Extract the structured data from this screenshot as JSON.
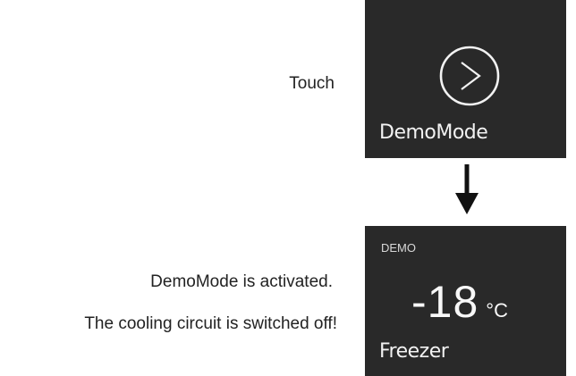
{
  "steps": {
    "touch": "Touch",
    "activated": "DemoMode is activated.",
    "warning": "The cooling circuit is switched off!"
  },
  "screen_top": {
    "label": "DemoMode",
    "button_icon": "chevron-right-circle-icon"
  },
  "screen_bottom": {
    "badge": "DEMO",
    "temperature": "-18",
    "unit": "°C",
    "label": "Freezer"
  },
  "colors": {
    "panel_bg": "#292929",
    "panel_text": "#f2f2f2",
    "page_text": "#222222",
    "arrow": "#111111"
  }
}
